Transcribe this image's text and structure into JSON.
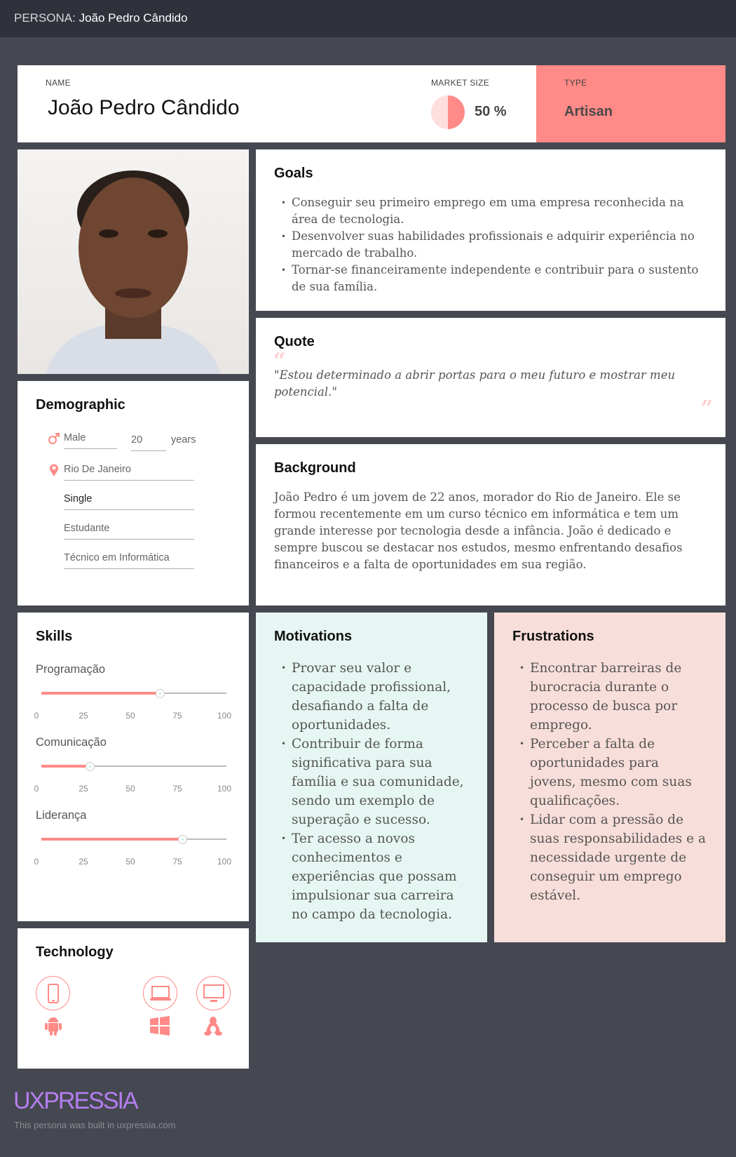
{
  "topbar": {
    "prefix": "PERSONA:",
    "name": "João Pedro Cândido"
  },
  "header": {
    "name_label": "NAME",
    "name": "João Pedro Cândido",
    "market_label": "MARKET SIZE",
    "market_value": "50 %",
    "market_fraction": 0.5,
    "type_label": "TYPE",
    "type": "Artisan"
  },
  "goals": {
    "title": "Goals",
    "items": [
      "Conseguir seu primeiro emprego em uma empresa reconhecida na área de tecnologia.",
      "Desenvolver suas habilidades profissionais e adquirir experiência no mercado de trabalho.",
      "Tornar-se financeiramente independente e contribuir para o sustento de sua família."
    ]
  },
  "quote": {
    "title": "Quote",
    "text": "\"Estou determinado a abrir portas para o meu futuro e mostrar meu potencial.\""
  },
  "background": {
    "title": "Background",
    "text": "João Pedro é um jovem de 22 anos, morador do Rio de Janeiro. Ele se formou recentemente em um curso técnico em informática e tem um grande interesse por tecnologia desde a infância. João é dedicado e sempre buscou se destacar nos estudos, mesmo enfrentando desafios financeiros e a falta de oportunidades em sua região."
  },
  "demographic": {
    "title": "Demographic",
    "gender": "Male",
    "age": "20",
    "age_unit": "years",
    "location": "Rio De Janeiro",
    "status": "Single",
    "occupation": "Estudante",
    "education": "Técnico em Informática"
  },
  "skills": {
    "title": "Skills",
    "ticks": [
      "0",
      "25",
      "50",
      "75",
      "100"
    ],
    "items": [
      {
        "label": "Programação",
        "value": 64
      },
      {
        "label": "Comunicação",
        "value": 26
      },
      {
        "label": "Liderança",
        "value": 76
      }
    ]
  },
  "motivations": {
    "title": "Motivations",
    "items": [
      "Provar seu valor e capacidade profissional, desafiando a falta de oportunidades.",
      "Contribuir de forma significativa para sua família e sua comunidade, sendo um exemplo de superação e sucesso.",
      "Ter acesso a novos conhecimentos e experiências que possam impulsionar sua carreira no campo da tecnologia."
    ]
  },
  "frustrations": {
    "title": "Frustrations",
    "items": [
      "Encontrar barreiras de burocracia durante o processo de busca por emprego.",
      "Perceber a falta de oportunidades para jovens, mesmo com suas qualificações.",
      "Lidar com a pressão de suas responsabilidades e a necessidade urgente de conseguir um emprego estável."
    ]
  },
  "technology": {
    "title": "Technology",
    "devices": [
      "mobile-icon",
      "laptop-icon",
      "desktop-icon"
    ],
    "os": [
      "android-icon",
      "windows-icon",
      "linux-icon"
    ]
  },
  "footer": {
    "logo": "UXPRESSIA",
    "text": "This persona was built in uxpressia.com"
  },
  "colors": {
    "accent": "#ff8a87",
    "motivations_bg": "#e6f7f3",
    "frustrations_bg": "#f8dedb",
    "logo": "#b57ef0"
  }
}
